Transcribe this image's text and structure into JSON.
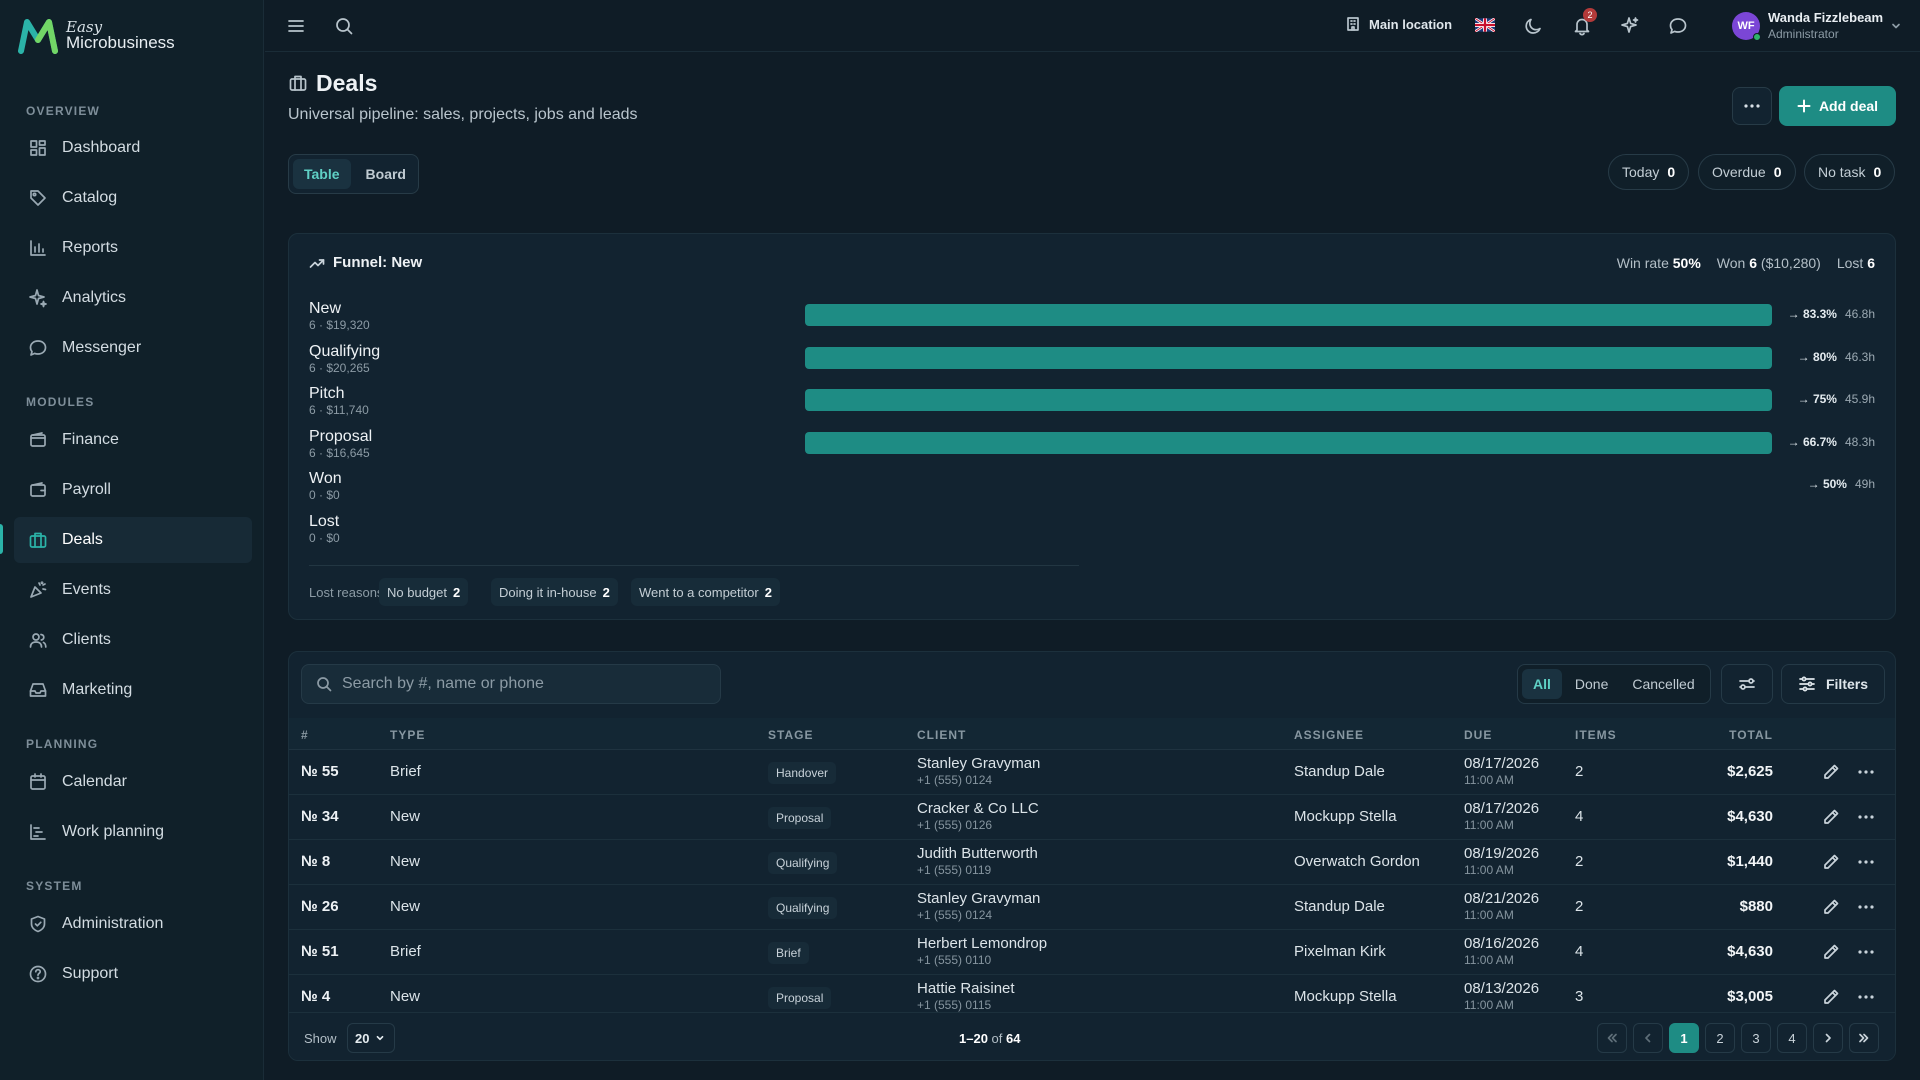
{
  "brand": {
    "tag": "Easy",
    "name": "Microbusiness",
    "logo_icon": "m-logo-icon",
    "logo_colors": [
      "#2bb3a8",
      "#7fdc5a"
    ]
  },
  "sidebar": {
    "sections": [
      {
        "title": "OVERVIEW",
        "items": [
          {
            "label": "Dashboard",
            "icon": "grid-icon"
          },
          {
            "label": "Catalog",
            "icon": "tag-icon"
          },
          {
            "label": "Reports",
            "icon": "bar-chart-icon"
          },
          {
            "label": "Analytics",
            "icon": "sparkle-icon"
          },
          {
            "label": "Messenger",
            "icon": "chat-icon"
          }
        ]
      },
      {
        "title": "MODULES",
        "items": [
          {
            "label": "Finance",
            "icon": "wallet-icon"
          },
          {
            "label": "Payroll",
            "icon": "wallet-icon"
          },
          {
            "label": "Deals",
            "icon": "briefcase-icon",
            "active": true
          },
          {
            "label": "Events",
            "icon": "party-icon"
          },
          {
            "label": "Clients",
            "icon": "users-icon"
          },
          {
            "label": "Marketing",
            "icon": "inbox-icon"
          }
        ]
      },
      {
        "title": "PLANNING",
        "items": [
          {
            "label": "Calendar",
            "icon": "calendar-icon"
          },
          {
            "label": "Work planning",
            "icon": "gantt-icon"
          }
        ]
      },
      {
        "title": "SYSTEM",
        "items": [
          {
            "label": "Administration",
            "icon": "shield-icon"
          },
          {
            "label": "Support",
            "icon": "help-icon"
          }
        ]
      }
    ]
  },
  "topbar": {
    "location": "Main location",
    "notifications_count": "2",
    "user": {
      "initials": "WF",
      "name": "Wanda Fizzlebeam",
      "role": "Administrator"
    },
    "accent": "#1e8c84"
  },
  "header": {
    "title": "Deals",
    "subtitle": "Universal pipeline: sales, projects, jobs and leads",
    "add_label": "Add deal",
    "views": [
      "Table",
      "Board"
    ],
    "active_view": "Table",
    "chips": [
      {
        "label": "Today",
        "count": "0"
      },
      {
        "label": "Overdue",
        "count": "0"
      },
      {
        "label": "No task",
        "count": "0"
      }
    ]
  },
  "funnel": {
    "title": "Funnel: New",
    "win_rate_label": "Win rate",
    "win_rate": "50%",
    "won_label": "Won",
    "won_count": "6",
    "won_amount": "($10,280)",
    "lost_label": "Lost",
    "lost_count": "6",
    "stages": [
      {
        "name": "New",
        "meta": "6 · $19,320",
        "fill": 1.0,
        "conv": "83.3%",
        "time": "46.8h"
      },
      {
        "name": "Qualifying",
        "meta": "6 · $20,265",
        "fill": 1.0,
        "conv": "80%",
        "time": "46.3h"
      },
      {
        "name": "Pitch",
        "meta": "6 · $11,740",
        "fill": 1.0,
        "conv": "75%",
        "time": "45.9h"
      },
      {
        "name": "Proposal",
        "meta": "6 · $16,645",
        "fill": 1.0,
        "conv": "66.7%",
        "time": "48.3h"
      },
      {
        "name": "Won",
        "meta": "0 · $0",
        "fill": 0,
        "conv": "50%",
        "time": "49h"
      },
      {
        "name": "Lost",
        "meta": "0 · $0",
        "fill": 0,
        "conv": "",
        "time": ""
      }
    ],
    "lost_reasons_label": "Lost reasons:",
    "lost_reasons": [
      {
        "label": "No budget",
        "count": "2"
      },
      {
        "label": "Doing it in-house",
        "count": "2"
      },
      {
        "label": "Went to a competitor",
        "count": "2"
      }
    ]
  },
  "table": {
    "search_placeholder": "Search by #, name or phone",
    "segments": [
      "All",
      "Done",
      "Cancelled"
    ],
    "active_segment": "All",
    "filters_label": "Filters",
    "columns": [
      "#",
      "TYPE",
      "STAGE",
      "CLIENT",
      "ASSIGNEE",
      "DUE",
      "ITEMS",
      "TOTAL"
    ],
    "rows": [
      {
        "num": "№ 55",
        "type": "Brief",
        "stage": "Handover",
        "client": "Stanley Gravyman",
        "phone": "+1 (555) 0124",
        "assignee": "Standup Dale",
        "due": "08/17/2026",
        "time": "11:00 AM",
        "items": "2",
        "total": "$2,625"
      },
      {
        "num": "№ 34",
        "type": "New",
        "stage": "Proposal",
        "client": "Cracker & Co LLC",
        "phone": "+1 (555) 0126",
        "assignee": "Mockupp Stella",
        "due": "08/17/2026",
        "time": "11:00 AM",
        "items": "4",
        "total": "$4,630"
      },
      {
        "num": "№ 8",
        "type": "New",
        "stage": "Qualifying",
        "client": "Judith Butterworth",
        "phone": "+1 (555) 0119",
        "assignee": "Overwatch Gordon",
        "due": "08/19/2026",
        "time": "11:00 AM",
        "items": "2",
        "total": "$1,440"
      },
      {
        "num": "№ 26",
        "type": "New",
        "stage": "Qualifying",
        "client": "Stanley Gravyman",
        "phone": "+1 (555) 0124",
        "assignee": "Standup Dale",
        "due": "08/21/2026",
        "time": "11:00 AM",
        "items": "2",
        "total": "$880"
      },
      {
        "num": "№ 51",
        "type": "Brief",
        "stage": "Brief",
        "client": "Herbert Lemondrop",
        "phone": "+1 (555) 0110",
        "assignee": "Pixelman Kirk",
        "due": "08/16/2026",
        "time": "11:00 AM",
        "items": "4",
        "total": "$4,630"
      },
      {
        "num": "№ 4",
        "type": "New",
        "stage": "Proposal",
        "client": "Hattie Raisinet",
        "phone": "+1 (555) 0115",
        "assignee": "Mockupp Stella",
        "due": "08/13/2026",
        "time": "11:00 AM",
        "items": "3",
        "total": "$3,005"
      }
    ],
    "footer": {
      "show_label": "Show",
      "page_size": "20",
      "range": "1–20",
      "of_label": "of",
      "total": "64",
      "pages": [
        "1",
        "2",
        "3",
        "4"
      ],
      "current_page": "1"
    }
  }
}
